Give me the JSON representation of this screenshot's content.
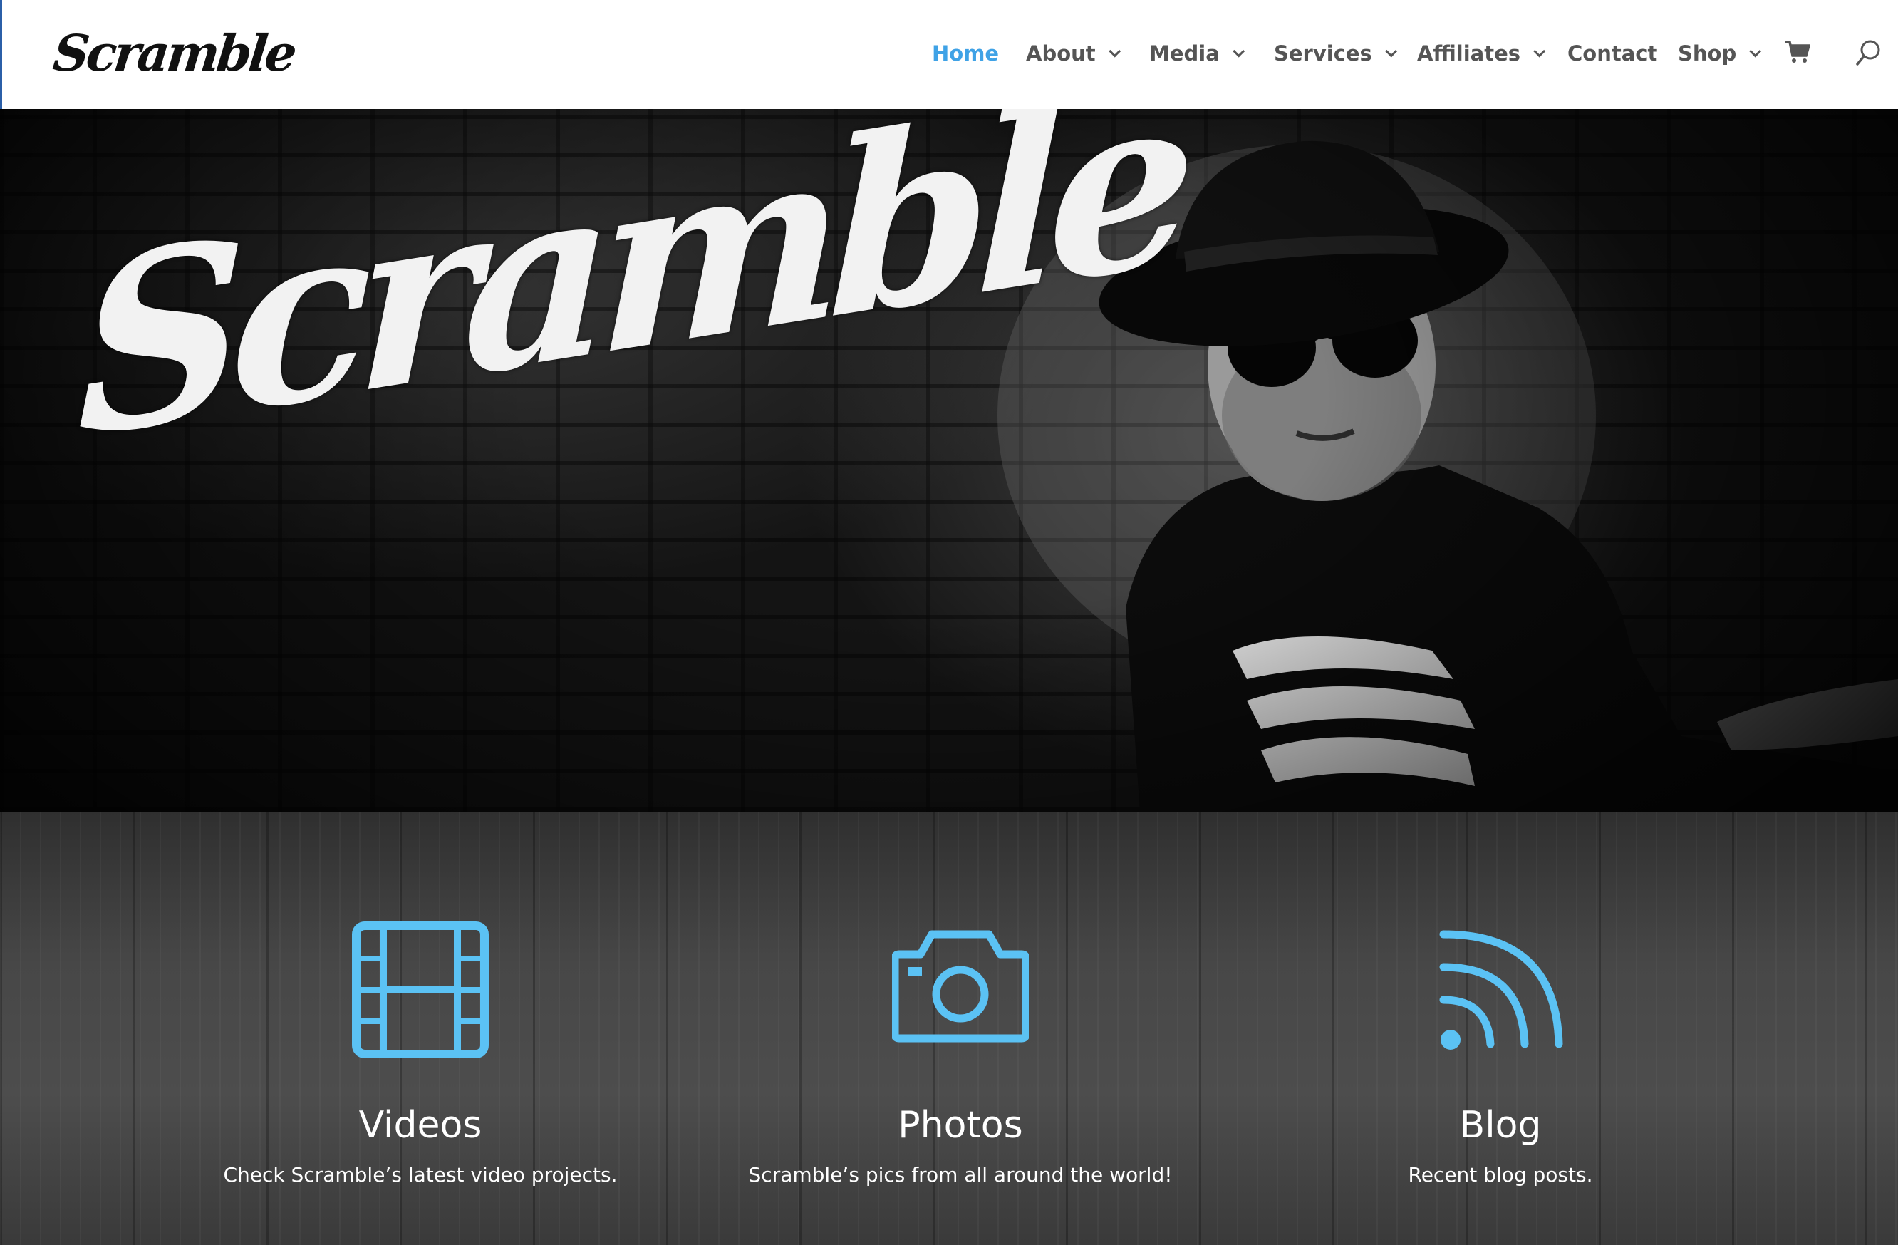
{
  "brand": {
    "logo_text": "Scramble",
    "accent_color": "#3fa2e6",
    "icon_color": "#5bc2f4"
  },
  "nav": {
    "items": [
      {
        "label": "Home",
        "active": true,
        "dropdown": false
      },
      {
        "label": "About",
        "active": false,
        "dropdown": true
      },
      {
        "label": "Media",
        "active": false,
        "dropdown": true
      },
      {
        "label": "Services",
        "active": false,
        "dropdown": true
      },
      {
        "label": "Affiliates",
        "active": false,
        "dropdown": true
      },
      {
        "label": "Contact",
        "active": false,
        "dropdown": false
      },
      {
        "label": "Shop",
        "active": false,
        "dropdown": true
      }
    ],
    "cart_icon": "cart-icon",
    "search_icon": "search-icon"
  },
  "hero": {
    "title": "Scramble"
  },
  "features": [
    {
      "icon": "film-strip-icon",
      "title": "Videos",
      "description": "Check Scramble’s latest video projects."
    },
    {
      "icon": "camera-icon",
      "title": "Photos",
      "description": "Scramble’s pics from all around the world!"
    },
    {
      "icon": "rss-feed-icon",
      "title": "Blog",
      "description": "Recent blog posts."
    }
  ]
}
